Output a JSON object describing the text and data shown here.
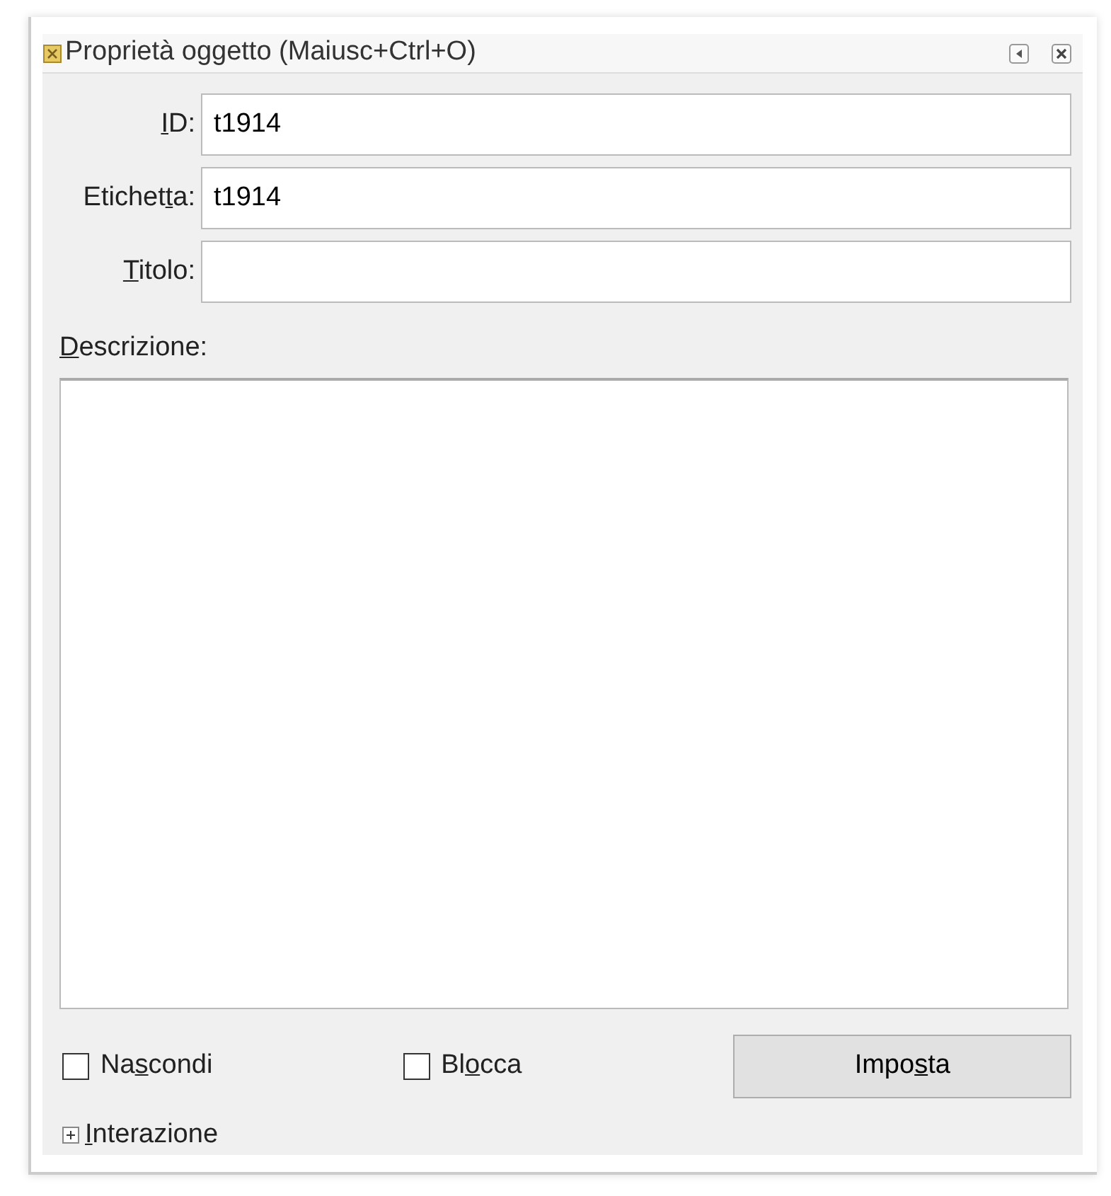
{
  "window": {
    "title": "Proprietà oggetto (Maiusc+Ctrl+O)"
  },
  "fields": [
    {
      "label": {
        "key": "I",
        "after": "D:"
      },
      "value": "t1914"
    },
    {
      "label": {
        "before": "Etichet",
        "key": "t",
        "after": "a:"
      },
      "value": "t1914"
    },
    {
      "label": {
        "key": "T",
        "after": "itolo:"
      }
    }
  ],
  "description": {
    "label": {
      "key": "D",
      "after": "escrizione:"
    }
  },
  "checkboxes": [
    {
      "label": {
        "before": "Na",
        "key": "s",
        "after": "condi"
      },
      "checked": false
    },
    {
      "label": {
        "before": "Bl",
        "key": "o",
        "after": "cca"
      },
      "checked": false
    }
  ],
  "button": {
    "label": {
      "before": "Impo",
      "key": "s",
      "after": "ta"
    }
  },
  "expander": {
    "label": {
      "key": "I",
      "after": "nterazione"
    },
    "expanded": false
  }
}
